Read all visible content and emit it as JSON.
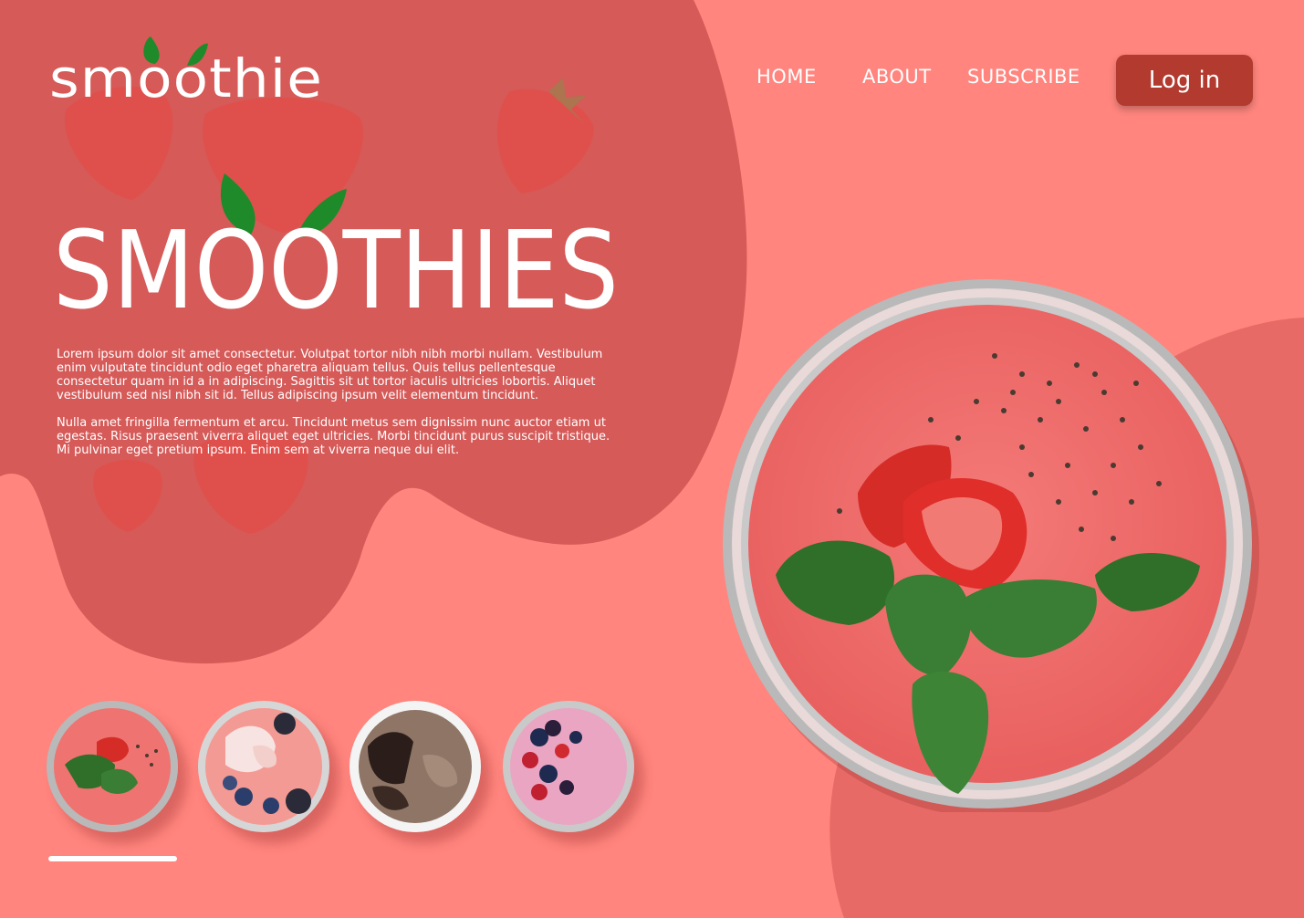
{
  "brand": {
    "logo_text": "smoothie"
  },
  "nav": {
    "home": "HOME",
    "about": "ABOUT",
    "subscribe": "SUBSCRIBE"
  },
  "header": {
    "login_label": "Log in"
  },
  "hero": {
    "title": "SMOOTHIES",
    "paragraph1": "Lorem ipsum dolor sit amet consectetur. Volutpat tortor nibh nibh morbi nullam. Vestibulum enim vulputate tincidunt odio eget pharetra aliquam tellus. Quis tellus pellentesque consectetur quam in id a in adipiscing. Sagittis sit ut tortor iaculis ultricies lobortis. Aliquet vestibulum sed nisl nibh sit id. Tellus adipiscing ipsum velit elementum tincidunt.",
    "paragraph2": "Nulla amet fringilla fermentum et arcu. Tincidunt metus sem dignissim nunc auctor etiam ut egestas. Risus praesent viverra aliquet eget ultricies. Morbi tincidunt purus suscipit tristique. Mi pulvinar eget pretium ipsum. Enim sem at viverra neque dui elit."
  },
  "gallery": {
    "thumbnails": [
      "strawberry-mint-smoothie",
      "flower-berry-smoothie",
      "chocolate-cookie-smoothie",
      "mixed-berry-smoothie"
    ],
    "active_index": 0
  },
  "colors": {
    "background": "#FF857E",
    "blob": "#D55A58",
    "button": "#B23A2F",
    "leaf": "#1E8A2A",
    "text": "#FFFFFF"
  }
}
